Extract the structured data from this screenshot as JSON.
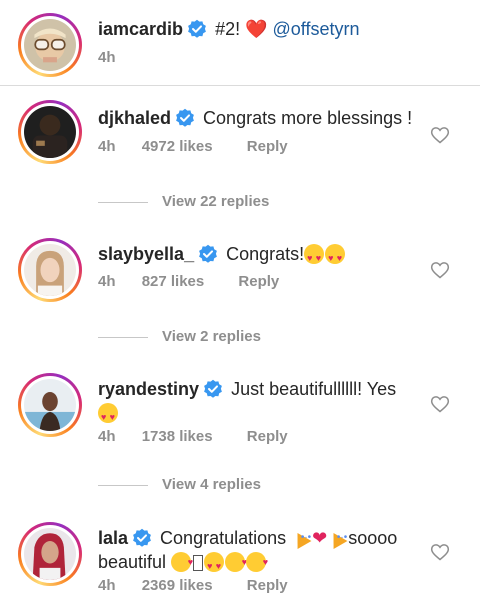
{
  "caption": {
    "username": "iamcardib",
    "text": "#2! ❤️",
    "mention": "@offsetyrn",
    "time": "4h"
  },
  "comments": [
    {
      "username": "djkhaled",
      "text": "Congrats more blessings !",
      "time": "4h",
      "likes": "4972 likes",
      "reply": "Reply",
      "view_replies": "View 22 replies"
    },
    {
      "username": "slaybyella_",
      "text": "Congrats!",
      "emojis": [
        "heart-eyes",
        "heart-eyes"
      ],
      "time": "4h",
      "likes": "827 likes",
      "reply": "Reply",
      "view_replies": "View 2 replies"
    },
    {
      "username": "ryandestiny",
      "text": "Just beautifullllll! Yes",
      "emojis": [
        "heart-eyes"
      ],
      "time": "4h",
      "likes": "1738 likes",
      "reply": "Reply",
      "view_replies": "View 4 replies"
    },
    {
      "username": "lala",
      "text_a": "Congratulations",
      "text_b": "soooo",
      "text_c": "beautiful",
      "emojis": [
        "party-popper",
        "red-heart",
        "party-popper",
        "kiss",
        "unknown-glyph",
        "heart-eyes",
        "kiss",
        "kiss"
      ],
      "time": "4h",
      "likes": "2369 likes",
      "reply": "Reply"
    }
  ],
  "colors": {
    "text": "#262626",
    "meta": "#8e8e8e",
    "mention": "#1c5a9a",
    "verified": "#3897f0",
    "heart": "#e0245e",
    "divider": "#dbdbdb"
  }
}
